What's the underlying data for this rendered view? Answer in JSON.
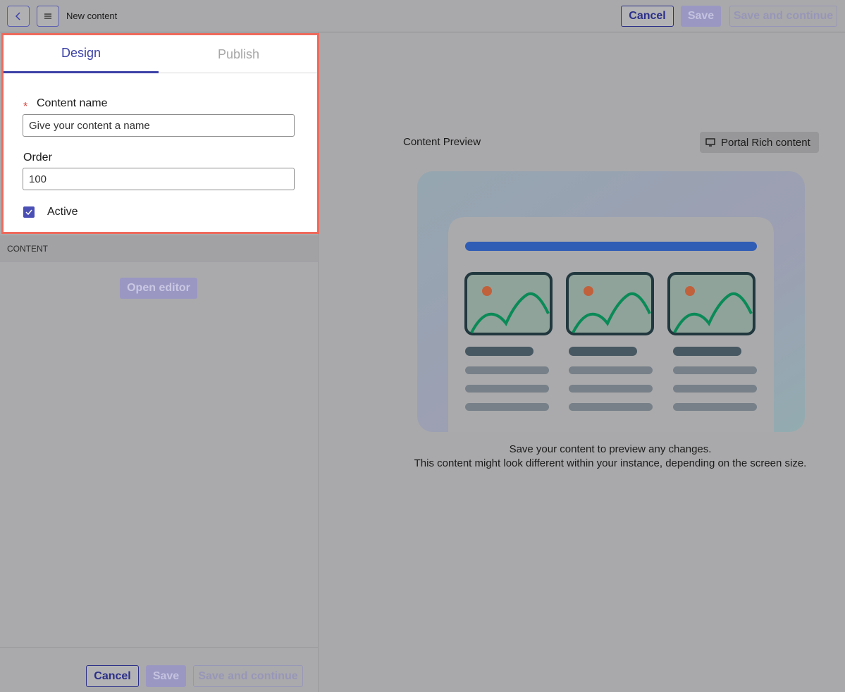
{
  "header": {
    "title": "New content",
    "cancel_label": "Cancel",
    "save_label": "Save",
    "save_continue_label": "Save and continue"
  },
  "tabs": [
    {
      "label": "Design",
      "active": true
    },
    {
      "label": "Publish",
      "active": false
    }
  ],
  "form": {
    "content_name_label": "Content name",
    "content_name_placeholder": "Give your content a name",
    "required_marker": "*",
    "order_label": "Order",
    "order_value": "100",
    "active_label": "Active",
    "active_checked": true
  },
  "content_section": {
    "header": "CONTENT",
    "open_editor_label": "Open editor"
  },
  "footer": {
    "cancel_label": "Cancel",
    "save_label": "Save",
    "save_continue_label": "Save and continue"
  },
  "preview": {
    "title": "Content Preview",
    "type_label": "Portal Rich content",
    "caption_line1": "Save your content to preview any changes.",
    "caption_line2": "This content might look different within your instance, depending on the screen size."
  },
  "colors": {
    "accent": "#3c41a6",
    "highlight_border": "#ee6a5c",
    "required": "#d8413a"
  },
  "icons": [
    "back-icon",
    "menu-icon",
    "checkmark-icon",
    "monitor-icon",
    "image-placeholder-icon"
  ]
}
